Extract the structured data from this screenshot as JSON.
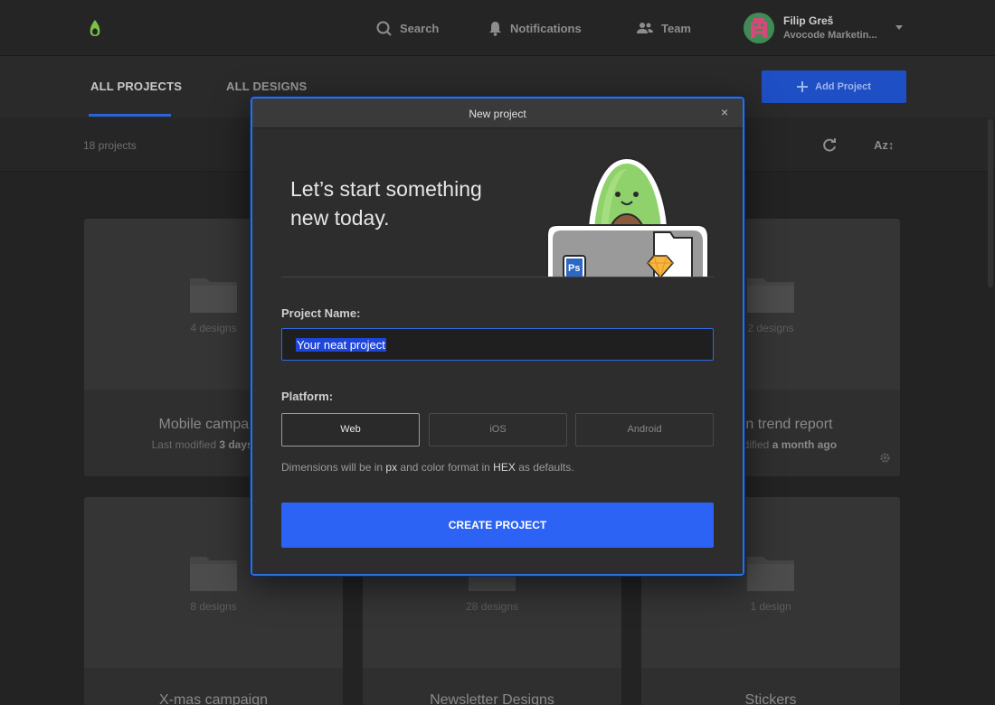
{
  "nav": {
    "search": "Search",
    "notifications": "Notifications",
    "team": "Team"
  },
  "user": {
    "name": "Filip Greš",
    "org": "Avocode Marketin..."
  },
  "tabs": {
    "all_projects": "ALL PROJECTS",
    "all_designs": "ALL DESIGNS"
  },
  "add_project_label": "Add Project",
  "projects_count": "18 projects",
  "sort_label": "Az",
  "cards": [
    {
      "count": "4 designs",
      "title": "Mobile campaign",
      "modified_prefix": "Last modified",
      "modified_value": "3 days ago"
    },
    {
      "count": "2 designs",
      "title": "Design trend report",
      "modified_prefix": "Last modified",
      "modified_value": "a month ago"
    },
    {
      "count": "8 designs",
      "title": "X-mas campaign"
    },
    {
      "count": "28 designs",
      "title": "Newsletter Designs"
    },
    {
      "count": "1 design",
      "title": "Stickers"
    }
  ],
  "modal": {
    "title": "New project",
    "close": "×",
    "headline": "Let’s start something new today.",
    "project_name_label": "Project Name:",
    "project_name_value": "Your neat project",
    "platform_label": "Platform:",
    "platforms": [
      "Web",
      "iOS",
      "Android"
    ],
    "selected_platform": "Web",
    "hint_prefix": "Dimensions will be in",
    "hint_unit": "px",
    "hint_middle": "and color format in",
    "hint_format": "HEX",
    "hint_suffix": "as defaults.",
    "create_label": "CREATE PROJECT"
  },
  "colors": {
    "accent": "#2c63f4",
    "modal_border": "#2b6fe0",
    "avocado_green": "#8fd16a"
  }
}
